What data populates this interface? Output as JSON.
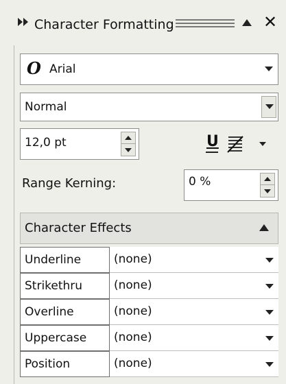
{
  "panel": {
    "title": "Character Formatting",
    "icons": {
      "collapse": "double-right-arrow-icon",
      "minimize": "triangle-up-icon",
      "close": "close-icon"
    },
    "close_glyph": "✕"
  },
  "font": {
    "family": "Arial",
    "type_icon_glyph": "O",
    "style": "Normal",
    "size": "12,0 pt"
  },
  "tools": {
    "underline_glyph": "U",
    "underline_icon": "underline-icon",
    "strike_icon": "strikethrough-icon"
  },
  "kerning": {
    "label": "Range Kerning:",
    "value": "0 %"
  },
  "effects": {
    "title": "Character Effects",
    "rows": [
      {
        "label": "Underline",
        "value": "(none)"
      },
      {
        "label": "Strikethru",
        "value": "(none)"
      },
      {
        "label": "Overline",
        "value": "(none)"
      },
      {
        "label": "Uppercase",
        "value": "(none)"
      },
      {
        "label": "Position",
        "value": "(none)"
      }
    ]
  },
  "colors": {
    "panel_bg": "#efefea",
    "field_bg": "#ffffff",
    "border": "#8c8c8c",
    "header_bg": "#e2e2de"
  }
}
